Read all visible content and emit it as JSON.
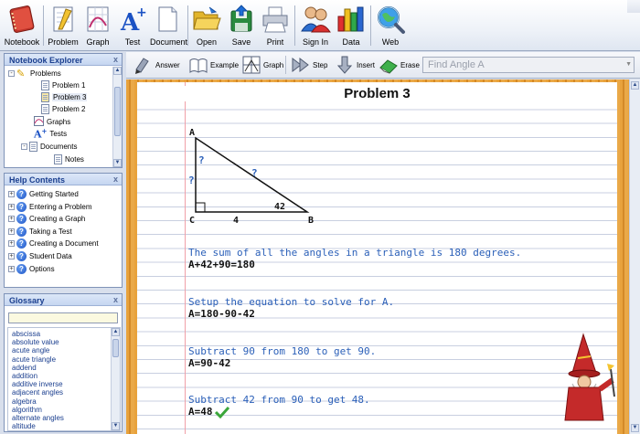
{
  "toolbar": {
    "buttons": [
      {
        "id": "notebook",
        "label": "Notebook",
        "icon": "notebook-icon"
      },
      {
        "id": "problem",
        "label": "Problem",
        "icon": "problem-icon"
      },
      {
        "id": "graph",
        "label": "Graph",
        "icon": "graph-icon"
      },
      {
        "id": "test",
        "label": "Test",
        "icon": "test-icon"
      },
      {
        "id": "document",
        "label": "Document",
        "icon": "document-icon"
      },
      {
        "id": "open",
        "label": "Open",
        "icon": "folder-open-icon"
      },
      {
        "id": "save",
        "label": "Save",
        "icon": "save-icon"
      },
      {
        "id": "print",
        "label": "Print",
        "icon": "printer-icon"
      },
      {
        "id": "signin",
        "label": "Sign In",
        "icon": "users-icon"
      },
      {
        "id": "data",
        "label": "Data",
        "icon": "bar-chart-icon"
      },
      {
        "id": "web",
        "label": "Web",
        "icon": "globe-magnifier-icon"
      }
    ]
  },
  "notebook_explorer": {
    "title": "Notebook Explorer",
    "close": "x",
    "items": [
      {
        "label": "Problems",
        "level": 1,
        "icon": "pencil-icon",
        "expander": "-"
      },
      {
        "label": "Problem 1",
        "level": 2,
        "icon": "document-icon"
      },
      {
        "label": "Problem 3",
        "level": 2,
        "icon": "document-icon",
        "selected": true
      },
      {
        "label": "Problem 2",
        "level": 2,
        "icon": "document-icon"
      },
      {
        "label": "Graphs",
        "level": 1,
        "icon": "graph-icon"
      },
      {
        "label": "Tests",
        "level": 1,
        "icon": "test-icon"
      },
      {
        "label": "Documents",
        "level": 1,
        "icon": "document-icon",
        "expander": "-"
      },
      {
        "label": "Notes",
        "level": 2,
        "icon": "document-icon"
      }
    ]
  },
  "help_contents": {
    "title": "Help Contents",
    "close": "x",
    "items": [
      "Getting Started",
      "Entering a Problem",
      "Creating a Graph",
      "Taking a Test",
      "Creating a Document",
      "Student Data",
      "Options"
    ]
  },
  "glossary": {
    "title": "Glossary",
    "close": "x",
    "search_value": "",
    "terms": [
      "abscissa",
      "absolute value",
      "acute angle",
      "acute triangle",
      "addend",
      "addition",
      "additive inverse",
      "adjacent angles",
      "algebra",
      "algorithm",
      "alternate angles",
      "altitude"
    ]
  },
  "toolbar2": {
    "buttons": [
      {
        "id": "answer",
        "label": "Answer",
        "icon": "answer-icon"
      },
      {
        "id": "example",
        "label": "Example",
        "icon": "book-icon"
      },
      {
        "id": "graph",
        "label": "Graph",
        "icon": "graph-icon"
      },
      {
        "id": "step",
        "label": "Step",
        "icon": "step-forward-icon"
      },
      {
        "id": "insert",
        "label": "Insert",
        "icon": "insert-arrow-icon"
      },
      {
        "id": "erase",
        "label": "Erase",
        "icon": "eraser-icon"
      }
    ],
    "topic_select": "Find Angle A"
  },
  "page": {
    "title": "Problem 3",
    "triangle": {
      "vertex_a": "A",
      "vertex_b": "B",
      "vertex_c": "C",
      "side_ac": "?",
      "side_ab": "?",
      "angle_a": "?",
      "angle_b": "42",
      "side_cb": "4"
    },
    "lines": [
      {
        "kind": "blue",
        "text": "The sum of all the angles in a triangle is 180 degrees."
      },
      {
        "kind": "black",
        "text": "A+42+90=180"
      },
      {
        "kind": "blue",
        "text": "Setup the equation to solve for A."
      },
      {
        "kind": "black",
        "text": "A=180-90-42"
      },
      {
        "kind": "blue",
        "text": "Subtract 90 from 180 to get 90."
      },
      {
        "kind": "black",
        "text": "A=90-42"
      },
      {
        "kind": "blue",
        "text": "Subtract 42 from 90 to get 48."
      },
      {
        "kind": "black",
        "text": "A=48"
      }
    ]
  },
  "colors": {
    "accent_blue": "#2a5fb8",
    "panel_header": "#1b3f8f",
    "notebook_orange": "#e39a33",
    "check_green": "#3aa63a"
  }
}
